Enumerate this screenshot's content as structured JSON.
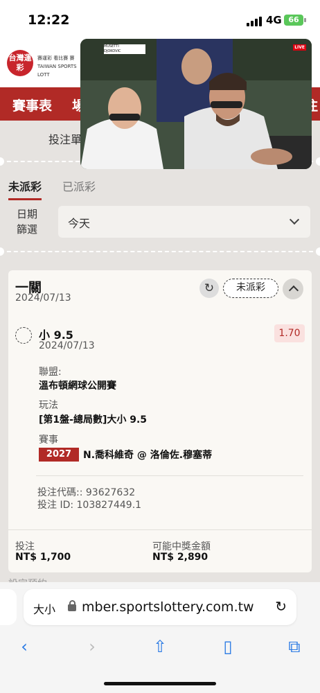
{
  "status_bar": {
    "time": "12:22",
    "network": "4G",
    "battery": "66"
  },
  "logo": {
    "text": "台灣運彩",
    "caption": "賽運彩 看比賽 賽 TAIWAN SPORTS LOTT"
  },
  "nav": {
    "items": [
      "賽事表",
      "場",
      "注"
    ]
  },
  "tab_strip": {
    "label": "投注單"
  },
  "status_tabs": {
    "active": "未派彩",
    "inactive": "已派彩"
  },
  "date_filter": {
    "label_line1": "日期",
    "label_line2": "篩選",
    "value": "今天"
  },
  "bet": {
    "type": "一關",
    "date": "2024/07/13",
    "status": "未派彩",
    "selection": "小 9.5",
    "selection_date": "2024/07/13",
    "odds": "1.70",
    "league_label": "聯盟:",
    "league": "溫布頓網球公開賽",
    "market_label": "玩法",
    "market": "[第1盤-總局數]大小 9.5",
    "event_label": "賽事",
    "event_id": "2027",
    "event": "N.喬科維奇 @ 洛倫佐.穆塞蒂",
    "bet_code": "投注代碼:: 93627632",
    "bet_id": "投注 ID: 103827449.1",
    "stake_label": "投注",
    "stake": "NT$ 1,700",
    "payout_label": "可能中獎金額",
    "payout": "NT$ 2,890"
  },
  "below": {
    "text": "設定預約"
  },
  "browser": {
    "size_label": "大小",
    "url": "mber.sportslottery.com.tw"
  },
  "video": {
    "scoreboard": {
      "p1": "MUSETTI",
      "p2": "DJOKOVIC"
    },
    "live": "LIVE"
  },
  "colors": {
    "brand_red": "#b12a26",
    "link_blue": "#2a7ae4",
    "battery_green": "#5ac75a"
  }
}
